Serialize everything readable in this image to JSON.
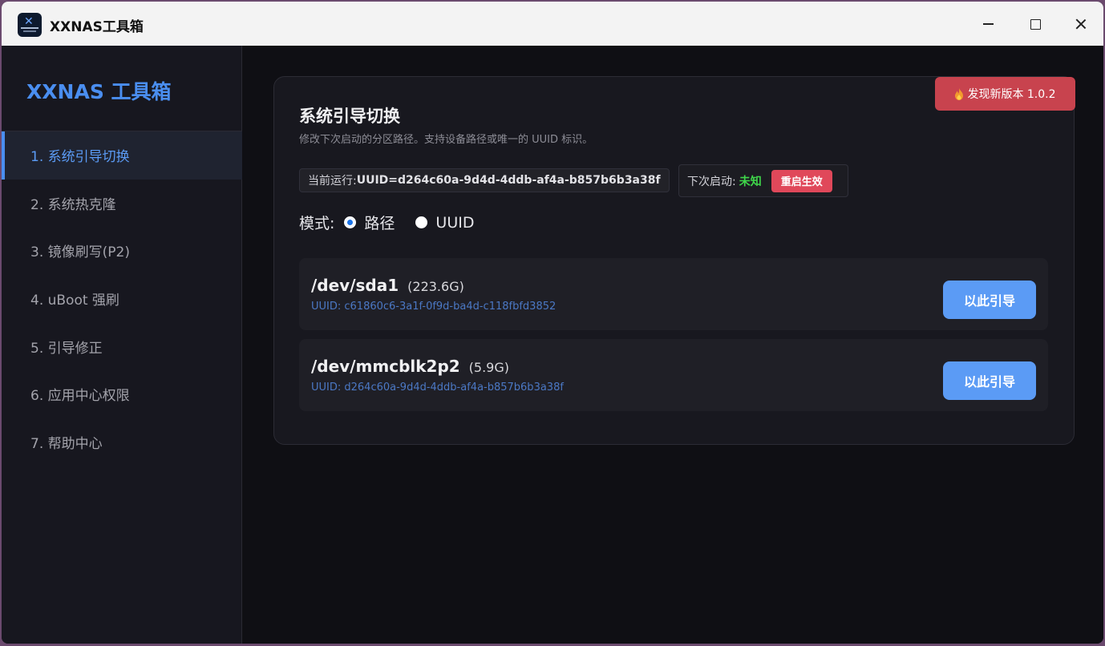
{
  "window": {
    "title": "XXNAS工具箱"
  },
  "sidebar": {
    "brand": "XXNAS 工具箱",
    "items": [
      {
        "label": "1. 系统引导切换",
        "active": true
      },
      {
        "label": "2. 系统热克隆"
      },
      {
        "label": "3. 镜像刷写(P2)"
      },
      {
        "label": "4. uBoot 强刷"
      },
      {
        "label": "5. 引导修正"
      },
      {
        "label": "6. 应用中心权限"
      },
      {
        "label": "7. 帮助中心"
      }
    ]
  },
  "update_badge": {
    "label": "发现新版本 1.0.2",
    "icon": "flame-icon"
  },
  "card": {
    "title": "系统引导切换",
    "desc": "修改下次启动的分区路径。支持设备路径或唯一的 UUID 标识。"
  },
  "status": {
    "current_label": "当前运行: ",
    "current_value": "UUID=d264c60a-9d4d-4ddb-af4a-b857b6b3a38f",
    "next_label": "下次启动:",
    "next_value": "未知",
    "reboot_label": "重启生效"
  },
  "mode": {
    "label": "模式:",
    "options": [
      {
        "label": "路径",
        "checked": true
      },
      {
        "label": "UUID",
        "checked": false
      }
    ]
  },
  "devices": [
    {
      "name": "/dev/sda1",
      "size": "(223.6G)",
      "uuid": "UUID: c61860c6-3a1f-0f9d-ba4d-c118fbfd3852",
      "button": "以此引导"
    },
    {
      "name": "/dev/mmcblk2p2",
      "size": "(5.9G)",
      "uuid": "UUID: d264c60a-9d4d-4ddb-af4a-b857b6b3a38f",
      "button": "以此引导"
    }
  ],
  "colors": {
    "accent": "#4a8ef0",
    "update_badge": "#c8434e",
    "reboot": "#e0485a",
    "status_unknown": "#3fd64a"
  }
}
